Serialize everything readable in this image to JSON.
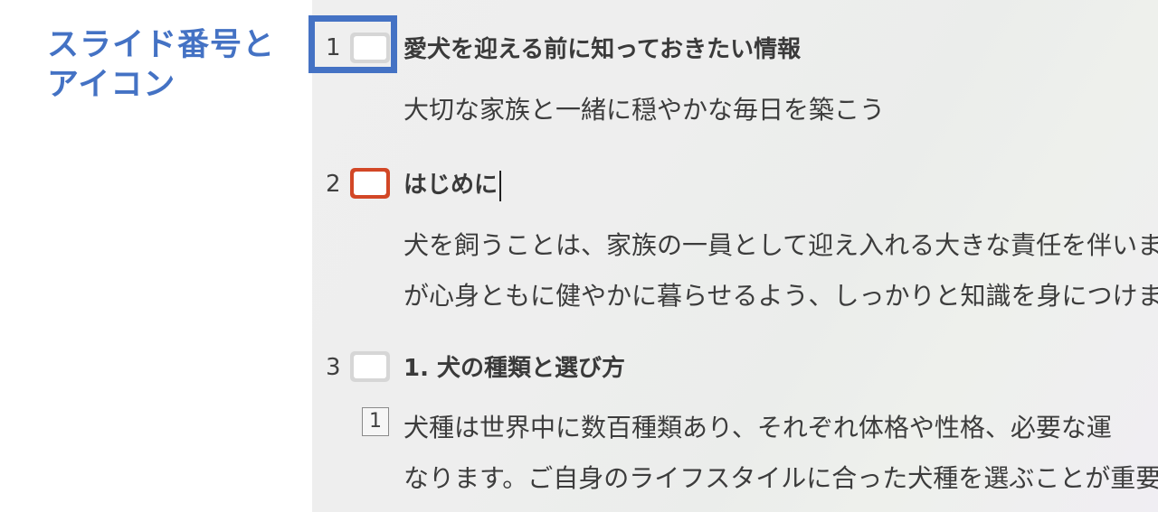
{
  "annotation": {
    "line1": "スライド番号と",
    "line2": "アイコン"
  },
  "outline": {
    "slides": [
      {
        "number": "1",
        "title": "愛犬を迎える前に知っておきたい情報",
        "body": [
          "大切な家族と一緒に穏やかな毎日を築こう"
        ]
      },
      {
        "number": "2",
        "title": "はじめに",
        "body": [
          "犬を飼うことは、家族の一員として迎え入れる大きな責任を伴いま",
          "が心身ともに健やかに暮らせるよう、しっかりと知識を身につけまし"
        ]
      },
      {
        "number": "3",
        "title": "1. 犬の種類と選び方",
        "level": "1",
        "body": [
          "犬種は世界中に数百種類あり、それぞれ体格や性格、必要な運",
          "なります。ご自身のライフスタイルに合った犬種を選ぶことが重要で"
        ]
      }
    ]
  },
  "colors": {
    "annotation_blue": "#4472c4",
    "active_icon": "#d24726",
    "inactive_icon": "#d6d6d6"
  }
}
